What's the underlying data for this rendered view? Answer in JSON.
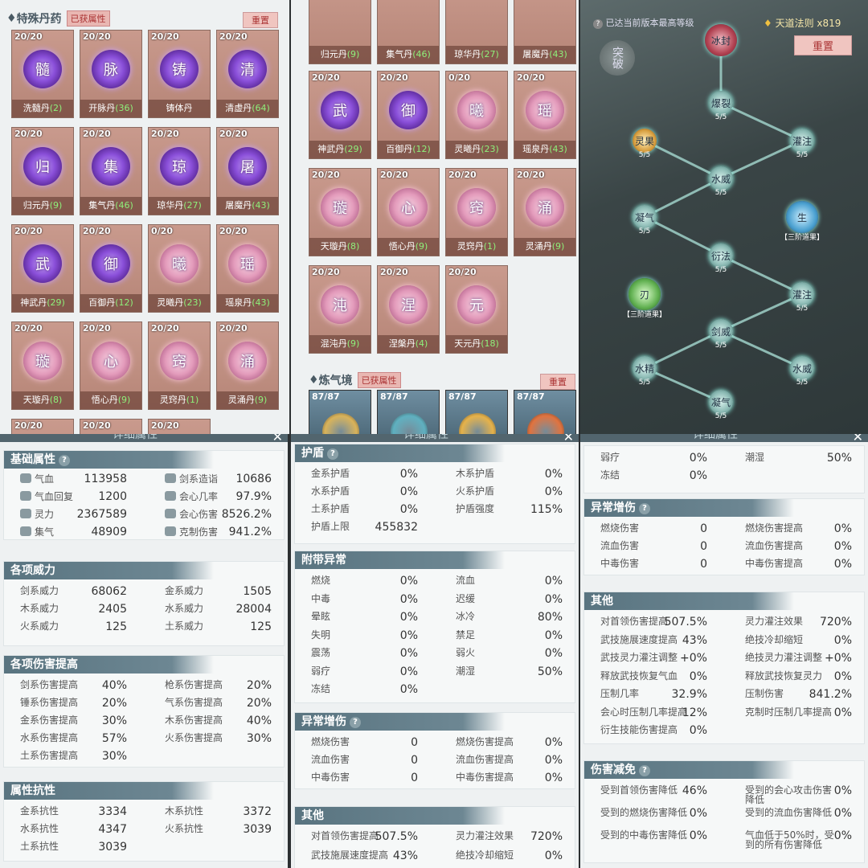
{
  "panel1": {
    "section_title": "特殊丹药",
    "tag": "已获属性",
    "reset": "重置",
    "cards": [
      {
        "count": "20/20",
        "glyph": "髓",
        "name": "洗髓丹",
        "num": "(2)",
        "tone": "v"
      },
      {
        "count": "20/20",
        "glyph": "脉",
        "name": "开脉丹",
        "num": "(36)",
        "tone": "v"
      },
      {
        "count": "20/20",
        "glyph": "铸",
        "name": "铸体丹",
        "num": "",
        "tone": "v"
      },
      {
        "count": "20/20",
        "glyph": "清",
        "name": "清虚丹",
        "num": "(64)",
        "tone": "v"
      },
      {
        "count": "20/20",
        "glyph": "归",
        "name": "归元丹",
        "num": "(9)",
        "tone": "v"
      },
      {
        "count": "20/20",
        "glyph": "集",
        "name": "集气丹",
        "num": "(46)",
        "tone": "v"
      },
      {
        "count": "20/20",
        "glyph": "琼",
        "name": "琼华丹",
        "num": "(27)",
        "tone": "v"
      },
      {
        "count": "20/20",
        "glyph": "屠",
        "name": "屠魔丹",
        "num": "(43)",
        "tone": "v"
      },
      {
        "count": "20/20",
        "glyph": "武",
        "name": "神武丹",
        "num": "(29)",
        "tone": "v"
      },
      {
        "count": "20/20",
        "glyph": "御",
        "name": "百御丹",
        "num": "(12)",
        "tone": "v"
      },
      {
        "count": "0/20",
        "glyph": "曦",
        "name": "灵曦丹",
        "num": "(23)",
        "tone": "p"
      },
      {
        "count": "20/20",
        "glyph": "瑶",
        "name": "瑶泉丹",
        "num": "(43)",
        "tone": "p"
      },
      {
        "count": "20/20",
        "glyph": "璇",
        "name": "天璇丹",
        "num": "(8)",
        "tone": "p"
      },
      {
        "count": "20/20",
        "glyph": "心",
        "name": "悟心丹",
        "num": "(9)",
        "tone": "p"
      },
      {
        "count": "20/20",
        "glyph": "窍",
        "name": "灵窍丹",
        "num": "(1)",
        "tone": "p"
      },
      {
        "count": "20/20",
        "glyph": "涌",
        "name": "灵涌丹",
        "num": "(9)",
        "tone": "p"
      }
    ],
    "partial_counts": [
      "20/20",
      "20/20",
      "20/20"
    ]
  },
  "panel2": {
    "top_cards": [
      {
        "name": "归元丹",
        "num": "(9)"
      },
      {
        "name": "集气丹",
        "num": "(46)"
      },
      {
        "name": "琼华丹",
        "num": "(27)"
      },
      {
        "name": "屠魔丹",
        "num": "(43)"
      }
    ],
    "cards": [
      {
        "count": "20/20",
        "glyph": "武",
        "name": "神武丹",
        "num": "(29)",
        "tone": "v"
      },
      {
        "count": "20/20",
        "glyph": "御",
        "name": "百御丹",
        "num": "(12)",
        "tone": "v"
      },
      {
        "count": "0/20",
        "glyph": "曦",
        "name": "灵曦丹",
        "num": "(23)",
        "tone": "p"
      },
      {
        "count": "20/20",
        "glyph": "瑶",
        "name": "瑶泉丹",
        "num": "(43)",
        "tone": "p"
      },
      {
        "count": "20/20",
        "glyph": "璇",
        "name": "天璇丹",
        "num": "(8)",
        "tone": "p"
      },
      {
        "count": "20/20",
        "glyph": "心",
        "name": "悟心丹",
        "num": "(9)",
        "tone": "p"
      },
      {
        "count": "20/20",
        "glyph": "窍",
        "name": "灵窍丹",
        "num": "(1)",
        "tone": "p"
      },
      {
        "count": "20/20",
        "glyph": "涌",
        "name": "灵涌丹",
        "num": "(9)",
        "tone": "p"
      },
      {
        "count": "20/20",
        "glyph": "沌",
        "name": "混沌丹",
        "num": "(9)",
        "tone": "p"
      },
      {
        "count": "20/20",
        "glyph": "涅",
        "name": "涅槃丹",
        "num": "(4)",
        "tone": "p"
      },
      {
        "count": "20/20",
        "glyph": "元",
        "name": "天元丹",
        "num": "(18)",
        "tone": "p"
      }
    ],
    "section2": "炼气境",
    "tag": "已获属性",
    "reset": "重置",
    "bottom_counts": [
      "87/87",
      "87/87",
      "87/87",
      "87/87"
    ]
  },
  "panel3": {
    "notice": "已达当前版本最高等级",
    "currency": "天道法则 x819",
    "reset": "重置",
    "breakthrough": "突破",
    "nodes": [
      {
        "g": "冰封",
        "lv": ""
      },
      {
        "g": "爆裂",
        "lv": "5/5"
      },
      {
        "g": "灵果",
        "lv": "5/5"
      },
      {
        "g": "灌注",
        "lv": "5/5"
      },
      {
        "g": "水威",
        "lv": "5/5"
      },
      {
        "g": "凝气",
        "lv": "5/5"
      },
      {
        "g": "生",
        "lv": "【三阶道果】"
      },
      {
        "g": "衍法",
        "lv": "5/5"
      },
      {
        "g": "刃",
        "lv": "【三阶道果】"
      },
      {
        "g": "灌注",
        "lv": "5/5"
      },
      {
        "g": "剑威",
        "lv": "5/5"
      },
      {
        "g": "水精",
        "lv": "5/5"
      },
      {
        "g": "水威",
        "lv": "5/5"
      },
      {
        "g": "凝气",
        "lv": "5/5"
      }
    ]
  },
  "stats1": {
    "title": "详细属性",
    "basic": {
      "title": "基础属性",
      "left": [
        [
          "气血",
          "113958"
        ],
        [
          "气血回复",
          "1200"
        ],
        [
          "灵力",
          "2367589"
        ],
        [
          "集气",
          "48909"
        ]
      ],
      "right": [
        [
          "剑系造诣",
          "10686"
        ],
        [
          "会心几率",
          "97.9%"
        ],
        [
          "会心伤害",
          "8526.2%"
        ],
        [
          "克制伤害",
          "941.2%"
        ]
      ]
    },
    "power": {
      "title": "各项威力",
      "left": [
        [
          "剑系威力",
          "68062"
        ],
        [
          "木系威力",
          "2405"
        ],
        [
          "火系威力",
          "125"
        ]
      ],
      "right": [
        [
          "金系威力",
          "1505"
        ],
        [
          "水系威力",
          "28004"
        ],
        [
          "土系威力",
          "125"
        ]
      ]
    },
    "dmg": {
      "title": "各项伤害提高",
      "left": [
        [
          "剑系伤害提高",
          "40%"
        ],
        [
          "锤系伤害提高",
          "20%"
        ],
        [
          "金系伤害提高",
          "30%"
        ],
        [
          "水系伤害提高",
          "57%"
        ],
        [
          "土系伤害提高",
          "30%"
        ]
      ],
      "right": [
        [
          "枪系伤害提高",
          "20%"
        ],
        [
          "气系伤害提高",
          "20%"
        ],
        [
          "木系伤害提高",
          "40%"
        ],
        [
          "火系伤害提高",
          "30%"
        ]
      ]
    },
    "res": {
      "title": "属性抗性",
      "left": [
        [
          "金系抗性",
          "3334"
        ],
        [
          "水系抗性",
          "4347"
        ],
        [
          "土系抗性",
          "3039"
        ]
      ],
      "right": [
        [
          "木系抗性",
          "3372"
        ],
        [
          "火系抗性",
          "3039"
        ]
      ]
    }
  },
  "stats2": {
    "title": "详细属性",
    "shield": {
      "title": "护盾",
      "left": [
        [
          "金系护盾",
          "0%"
        ],
        [
          "水系护盾",
          "0%"
        ],
        [
          "土系护盾",
          "0%"
        ],
        [
          "护盾上限",
          "455832"
        ]
      ],
      "right": [
        [
          "木系护盾",
          "0%"
        ],
        [
          "火系护盾",
          "0%"
        ],
        [
          "护盾强度",
          "115%"
        ]
      ]
    },
    "abn": {
      "title": "附带异常",
      "left": [
        [
          "燃烧",
          "0%"
        ],
        [
          "中毒",
          "0%"
        ],
        [
          "晕眩",
          "0%"
        ],
        [
          "失明",
          "0%"
        ],
        [
          "震荡",
          "0%"
        ],
        [
          "弱疗",
          "0%"
        ],
        [
          "冻结",
          "0%"
        ]
      ],
      "right": [
        [
          "流血",
          "0%"
        ],
        [
          "迟缓",
          "0%"
        ],
        [
          "冰冷",
          "80%"
        ],
        [
          "禁足",
          "0%"
        ],
        [
          "弱火",
          "0%"
        ],
        [
          "潮湿",
          "50%"
        ]
      ]
    },
    "abninc": {
      "title": "异常增伤",
      "left": [
        [
          "燃烧伤害",
          "0"
        ],
        [
          "流血伤害",
          "0"
        ],
        [
          "中毒伤害",
          "0"
        ]
      ],
      "right": [
        [
          "燃烧伤害提高",
          "0%"
        ],
        [
          "流血伤害提高",
          "0%"
        ],
        [
          "中毒伤害提高",
          "0%"
        ]
      ]
    },
    "other": {
      "title": "其他",
      "left": [
        [
          "对首领伤害提高",
          "507.5%"
        ],
        [
          "武技施展速度提高",
          "43%"
        ]
      ],
      "right": [
        [
          "灵力灌注效果",
          "720%"
        ],
        [
          "绝技冷却缩短",
          "0%"
        ]
      ]
    }
  },
  "stats3": {
    "title": "详细属性",
    "top": {
      "left": [
        [
          "弱疗",
          "0%"
        ],
        [
          "冻结",
          "0%"
        ]
      ],
      "right": [
        [
          "潮湿",
          "50%"
        ]
      ]
    },
    "abninc": {
      "title": "异常增伤",
      "left": [
        [
          "燃烧伤害",
          "0"
        ],
        [
          "流血伤害",
          "0"
        ],
        [
          "中毒伤害",
          "0"
        ]
      ],
      "right": [
        [
          "燃烧伤害提高",
          "0%"
        ],
        [
          "流血伤害提高",
          "0%"
        ],
        [
          "中毒伤害提高",
          "0%"
        ]
      ]
    },
    "other": {
      "title": "其他",
      "left": [
        [
          "对首领伤害提高",
          "507.5%"
        ],
        [
          "武技施展速度提高",
          "43%"
        ],
        [
          "武技灵力灌注调整",
          "+0%"
        ],
        [
          "释放武技恢复气血",
          "0%"
        ],
        [
          "压制几率",
          "32.9%"
        ],
        [
          "会心时压制几率提高",
          "12%"
        ],
        [
          "衍生技能伤害提高",
          "0%"
        ]
      ],
      "right": [
        [
          "灵力灌注效果",
          "720%"
        ],
        [
          "绝技冷却缩短",
          "0%"
        ],
        [
          "绝技灵力灌注调整",
          "+0%"
        ],
        [
          "释放武技恢复灵力",
          "0%"
        ],
        [
          "压制伤害",
          "841.2%"
        ],
        [
          "克制时压制几率提高",
          "0%"
        ]
      ]
    },
    "reduce": {
      "title": "伤害减免",
      "left": [
        [
          "受到首领伤害降低",
          "46%"
        ],
        [
          "受到的燃烧伤害降低",
          "0%"
        ],
        [
          "受到的中毒伤害降低",
          "0%"
        ]
      ],
      "right": [
        [
          "受到的会心攻击伤害降低",
          "0%"
        ],
        [
          "受到的流血伤害降低",
          "0%"
        ],
        [
          "气血低于50%时，受到的所有伤害降低",
          "0%"
        ]
      ]
    }
  }
}
